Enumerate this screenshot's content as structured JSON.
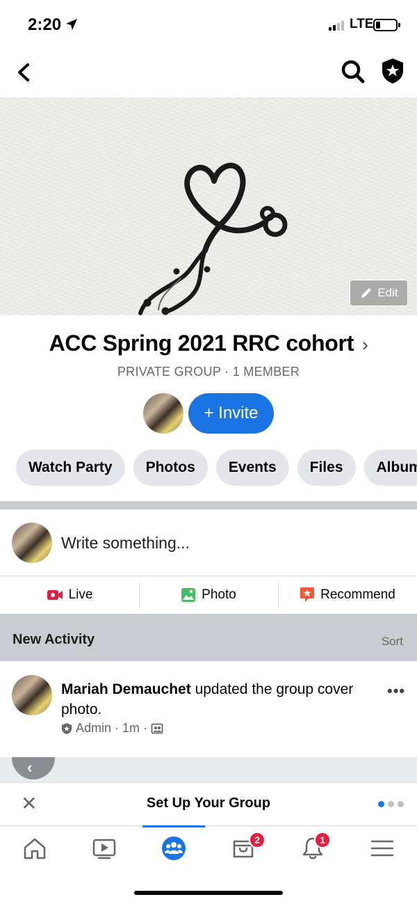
{
  "status_bar": {
    "time": "2:20",
    "network": "LTE"
  },
  "cover": {
    "edit_label": "Edit"
  },
  "group": {
    "name": "ACC Spring 2021 RRC cohort",
    "subtitle": "PRIVATE GROUP · 1 MEMBER",
    "invite_label": "+ Invite"
  },
  "pills": [
    "Watch Party",
    "Photos",
    "Events",
    "Files",
    "Albums"
  ],
  "composer": {
    "placeholder": "Write something...",
    "actions": [
      {
        "label": "Live",
        "icon": "live-video-icon",
        "color": "#e41e3f"
      },
      {
        "label": "Photo",
        "icon": "photo-icon",
        "color": "#45bd62"
      },
      {
        "label": "Recommend",
        "icon": "recommend-icon",
        "color": "#f0573b"
      }
    ]
  },
  "activity": {
    "header": "New Activity",
    "sort_label": "Sort",
    "post": {
      "author": "Mariah Demauchet",
      "text": " updated the group cover photo.",
      "role": "Admin",
      "time": "· 1m ·"
    }
  },
  "setup_banner": {
    "title": "Set Up Your Group",
    "page_index": 1,
    "page_count": 3
  },
  "tab_bar": {
    "tabs": [
      {
        "name": "home",
        "icon": "home-icon"
      },
      {
        "name": "watch",
        "icon": "video-icon"
      },
      {
        "name": "groups",
        "icon": "groups-icon",
        "active": true
      },
      {
        "name": "marketplace",
        "icon": "marketplace-icon",
        "badge": "2"
      },
      {
        "name": "notifications",
        "icon": "bell-icon",
        "badge": "1"
      },
      {
        "name": "menu",
        "icon": "menu-icon"
      }
    ]
  },
  "colors": {
    "accent": "#1b74e4",
    "badge": "#e41e3f",
    "pill_bg": "#e4e6eb"
  }
}
